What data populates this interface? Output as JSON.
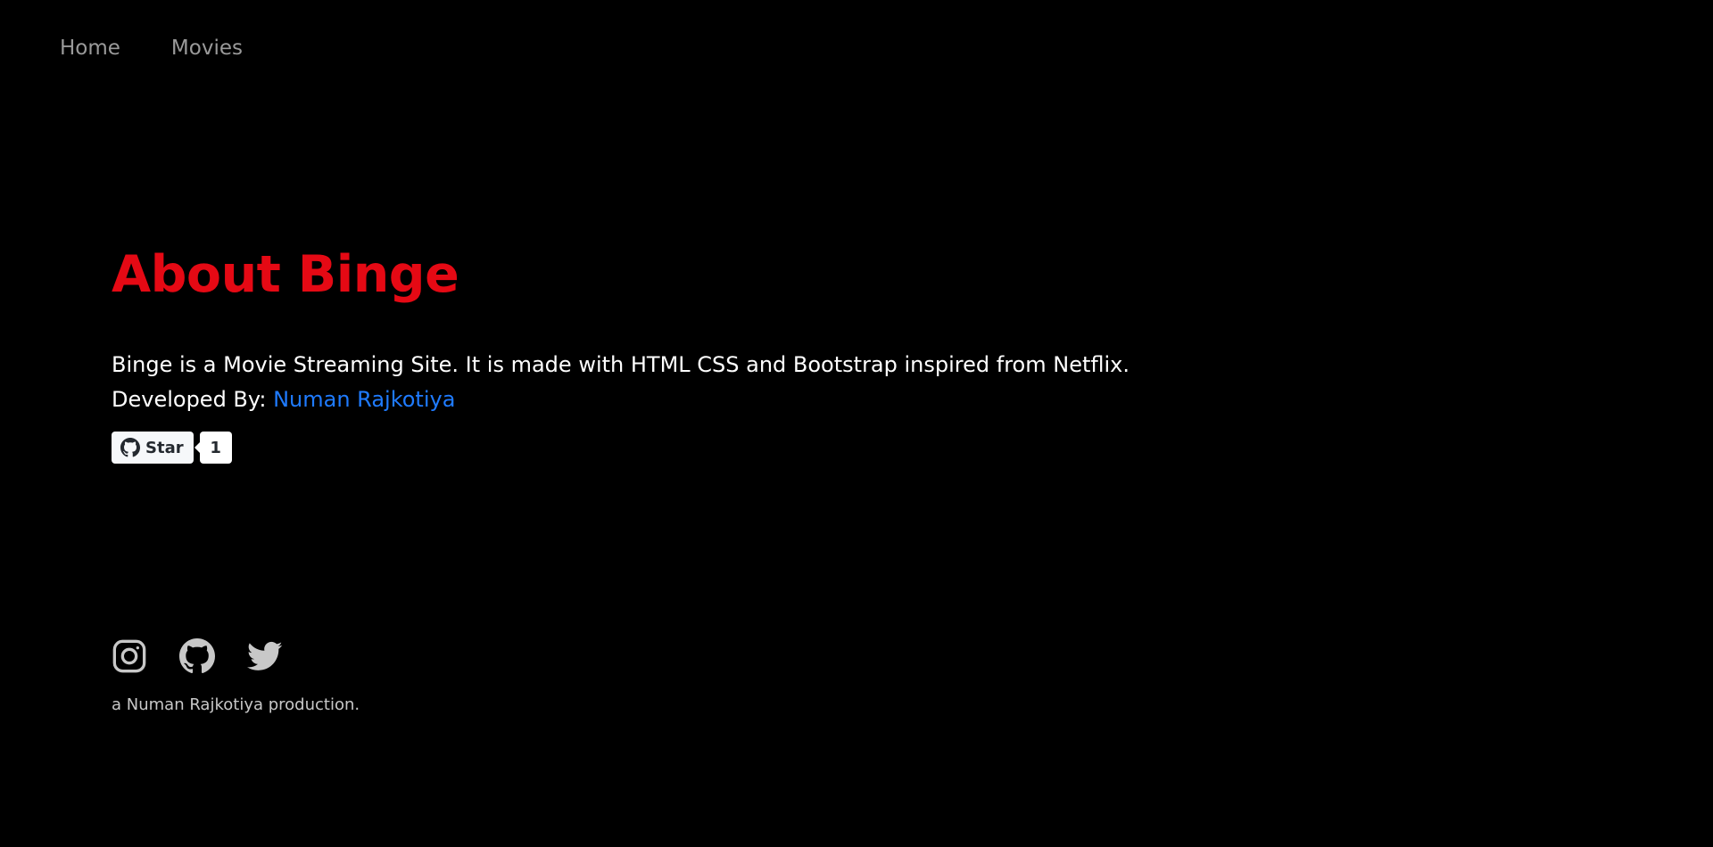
{
  "nav": {
    "items": [
      {
        "label": "Home"
      },
      {
        "label": "Movies"
      }
    ]
  },
  "about": {
    "title": "About Binge",
    "description": "Binge is a Movie Streaming Site. It is made with HTML CSS and Bootstrap inspired from Netflix.",
    "developed_by_label": "Developed By: ",
    "developer_name": "Numan Rajkotiya"
  },
  "github_star": {
    "label": "Star",
    "count": "1",
    "icon": "github-icon"
  },
  "footer": {
    "socials": [
      {
        "icon": "instagram-icon"
      },
      {
        "icon": "github-icon"
      },
      {
        "icon": "twitter-icon"
      }
    ],
    "credit": "a Numan Rajkotiya production."
  },
  "colors": {
    "background": "#000000",
    "accent": "#e50914",
    "link": "#1f7bff",
    "nav_text": "#9a9a9a",
    "social_icons": "#c8c8c8"
  }
}
